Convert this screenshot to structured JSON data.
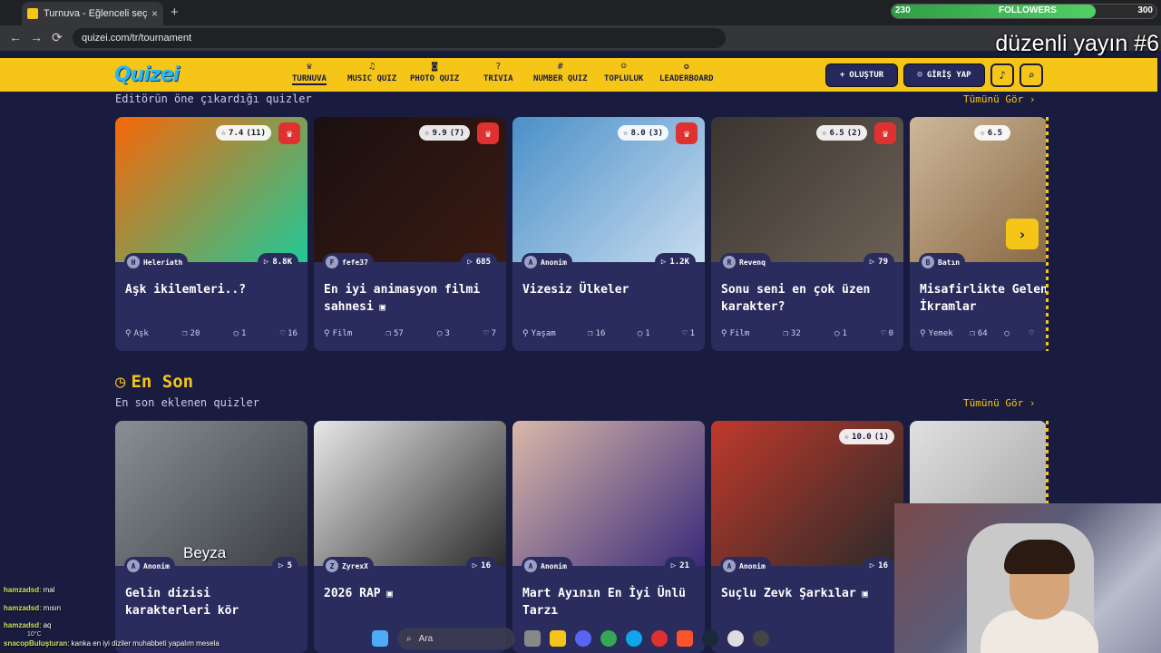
{
  "browser": {
    "tab_title": "Turnuva - Eğlenceli seçimler ya",
    "tab_close": "×",
    "new_tab": "+",
    "url": "quizei.com/tr/tournament",
    "back": "←",
    "forward": "→",
    "reload": "⟳"
  },
  "stream": {
    "followers_label": "FOLLOWERS",
    "followers_current": "230",
    "followers_goal": "300",
    "followers_progress": 0.77,
    "overlay_title": "düzenli yayın #6",
    "chat": [
      {
        "user": "hamzadsd",
        "msg": ": mal"
      },
      {
        "user": "hamzadsd",
        "msg": ": mısın"
      },
      {
        "user": "hamzadsd",
        "msg": ": aq"
      },
      {
        "user": "snacopBuluşturan",
        "msg": ": kanka en iyi diziler muhabbeti yapalım mesela"
      }
    ],
    "weather": "10°C"
  },
  "site": {
    "logo": "Quizei",
    "nav": [
      {
        "icon": "trophy-icon",
        "glyph": "♛",
        "label": "TURNUVA"
      },
      {
        "icon": "music-icon",
        "glyph": "♫",
        "label": "MUSIC QUIZ"
      },
      {
        "icon": "camera-icon",
        "glyph": "◙",
        "label": "PHOTO QUIZ"
      },
      {
        "icon": "question-icon",
        "glyph": "?",
        "label": "TRIVIA"
      },
      {
        "icon": "hash-icon",
        "glyph": "#",
        "label": "NUMBER QUIZ"
      },
      {
        "icon": "users-icon",
        "glyph": "☺",
        "label": "TOPLULUK"
      },
      {
        "icon": "medal-icon",
        "glyph": "✪",
        "label": "LEADERBOARD"
      }
    ],
    "create_label": "OLUŞTUR",
    "create_glyph": "+",
    "login_label": "GİRİŞ YAP",
    "login_glyph": "☺",
    "bell_glyph": "♪",
    "search_glyph": "⌕"
  },
  "featured": {
    "subtitle": "Editörün öne çıkardığı quizler",
    "see_all": "Tümünü Gör ›",
    "cards": [
      {
        "rating": "7.4",
        "votes": "(11)",
        "author": "Heleriath",
        "avatar": "H",
        "plays": "8.8K",
        "title": "Aşk ikilemleri..?",
        "video": false,
        "category": "Aşk",
        "items": "20",
        "comments": "1",
        "likes": "16",
        "colors": [
          "#f76707",
          "#20c997"
        ]
      },
      {
        "rating": "9.9",
        "votes": "(7)",
        "author": "fefe37",
        "avatar": "F",
        "plays": "685",
        "title": "En iyi animasyon filmi sahnesi",
        "video": true,
        "category": "Film",
        "items": "57",
        "comments": "3",
        "likes": "7",
        "colors": [
          "#1a1010",
          "#3a1a12"
        ]
      },
      {
        "rating": "8.0",
        "votes": "(3)",
        "author": "Anonim",
        "avatar": "A",
        "plays": "1.2K",
        "title": "Vizesiz Ülkeler",
        "video": false,
        "category": "Yaşam",
        "items": "16",
        "comments": "1",
        "likes": "1",
        "colors": [
          "#4a90c8",
          "#c8dcef"
        ]
      },
      {
        "rating": "6.5",
        "votes": "(2)",
        "author": "Revenq",
        "avatar": "R",
        "plays": "79",
        "title": "Sonu seni en çok üzen karakter?",
        "video": false,
        "category": "Film",
        "items": "32",
        "comments": "1",
        "likes": "0",
        "colors": [
          "#3a3530",
          "#6b6055"
        ]
      },
      {
        "rating": "6.5",
        "votes": "",
        "author": "Batın",
        "avatar": "B",
        "plays": "",
        "title": "Misafirlikte Gelen Kötü İkramlar",
        "video": false,
        "category": "Yemek",
        "items": "64",
        "comments": "",
        "likes": "",
        "colors": [
          "#cdb79a",
          "#8a6a45"
        ]
      }
    ]
  },
  "latest": {
    "title": "En Son",
    "subtitle": "En son eklenen quizler",
    "see_all": "Tümünü Gör ›",
    "cards": [
      {
        "rating": "",
        "votes": "",
        "author": "Anonim",
        "avatar": "A",
        "plays": "5",
        "title": "Gelin dizisi karakterleri kör",
        "video": false,
        "image_text": "Beyza",
        "colors": [
          "#8a8f96",
          "#3a3e44"
        ]
      },
      {
        "rating": "",
        "votes": "",
        "author": "ZyrexX",
        "avatar": "Z",
        "plays": "16",
        "title": "2026 RAP",
        "video": true,
        "image_text": "",
        "colors": [
          "#e8e8e8",
          "#2a2a2a"
        ]
      },
      {
        "rating": "",
        "votes": "",
        "author": "Anonim",
        "avatar": "A",
        "plays": "21",
        "title": "Mart Ayının En İyi Ünlü Tarzı",
        "video": false,
        "image_text": "",
        "colors": [
          "#d9b8a8",
          "#3a2a7a"
        ]
      },
      {
        "rating": "10.0",
        "votes": "(1)",
        "author": "Anonim",
        "avatar": "A",
        "plays": "16",
        "title": "Suçlu Zevk Şarkılar",
        "video": true,
        "image_text": "",
        "colors": [
          "#c0392b",
          "#2a2a2a"
        ]
      },
      {
        "rating": "",
        "votes": "",
        "author": "",
        "avatar": "",
        "plays": "",
        "title": "",
        "video": false,
        "image_text": "",
        "colors": [
          "#e0e0e0",
          "#a0a0a0"
        ]
      }
    ]
  },
  "taskbar": {
    "search_label": "Ara"
  },
  "colors": {
    "accent": "#f5c518",
    "background": "#1a1c3f",
    "card": "#2a2c5e",
    "crown": "#e03131"
  }
}
